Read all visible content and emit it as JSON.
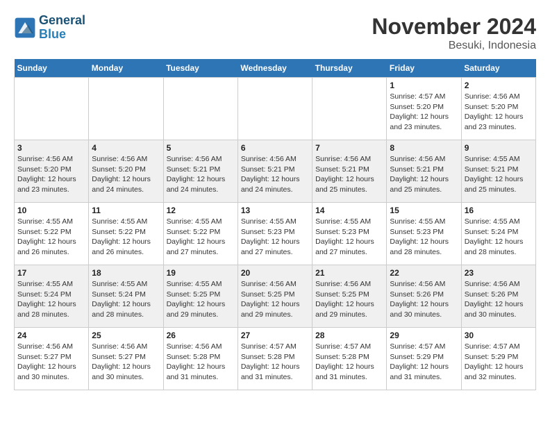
{
  "header": {
    "logo_general": "General",
    "logo_blue": "Blue",
    "month_title": "November 2024",
    "location": "Besuki, Indonesia"
  },
  "weekdays": [
    "Sunday",
    "Monday",
    "Tuesday",
    "Wednesday",
    "Thursday",
    "Friday",
    "Saturday"
  ],
  "weeks": [
    [
      {
        "day": "",
        "info": ""
      },
      {
        "day": "",
        "info": ""
      },
      {
        "day": "",
        "info": ""
      },
      {
        "day": "",
        "info": ""
      },
      {
        "day": "",
        "info": ""
      },
      {
        "day": "1",
        "info": "Sunrise: 4:57 AM\nSunset: 5:20 PM\nDaylight: 12 hours and 23 minutes."
      },
      {
        "day": "2",
        "info": "Sunrise: 4:56 AM\nSunset: 5:20 PM\nDaylight: 12 hours and 23 minutes."
      }
    ],
    [
      {
        "day": "3",
        "info": "Sunrise: 4:56 AM\nSunset: 5:20 PM\nDaylight: 12 hours and 23 minutes."
      },
      {
        "day": "4",
        "info": "Sunrise: 4:56 AM\nSunset: 5:20 PM\nDaylight: 12 hours and 24 minutes."
      },
      {
        "day": "5",
        "info": "Sunrise: 4:56 AM\nSunset: 5:21 PM\nDaylight: 12 hours and 24 minutes."
      },
      {
        "day": "6",
        "info": "Sunrise: 4:56 AM\nSunset: 5:21 PM\nDaylight: 12 hours and 24 minutes."
      },
      {
        "day": "7",
        "info": "Sunrise: 4:56 AM\nSunset: 5:21 PM\nDaylight: 12 hours and 25 minutes."
      },
      {
        "day": "8",
        "info": "Sunrise: 4:56 AM\nSunset: 5:21 PM\nDaylight: 12 hours and 25 minutes."
      },
      {
        "day": "9",
        "info": "Sunrise: 4:55 AM\nSunset: 5:21 PM\nDaylight: 12 hours and 25 minutes."
      }
    ],
    [
      {
        "day": "10",
        "info": "Sunrise: 4:55 AM\nSunset: 5:22 PM\nDaylight: 12 hours and 26 minutes."
      },
      {
        "day": "11",
        "info": "Sunrise: 4:55 AM\nSunset: 5:22 PM\nDaylight: 12 hours and 26 minutes."
      },
      {
        "day": "12",
        "info": "Sunrise: 4:55 AM\nSunset: 5:22 PM\nDaylight: 12 hours and 27 minutes."
      },
      {
        "day": "13",
        "info": "Sunrise: 4:55 AM\nSunset: 5:23 PM\nDaylight: 12 hours and 27 minutes."
      },
      {
        "day": "14",
        "info": "Sunrise: 4:55 AM\nSunset: 5:23 PM\nDaylight: 12 hours and 27 minutes."
      },
      {
        "day": "15",
        "info": "Sunrise: 4:55 AM\nSunset: 5:23 PM\nDaylight: 12 hours and 28 minutes."
      },
      {
        "day": "16",
        "info": "Sunrise: 4:55 AM\nSunset: 5:24 PM\nDaylight: 12 hours and 28 minutes."
      }
    ],
    [
      {
        "day": "17",
        "info": "Sunrise: 4:55 AM\nSunset: 5:24 PM\nDaylight: 12 hours and 28 minutes."
      },
      {
        "day": "18",
        "info": "Sunrise: 4:55 AM\nSunset: 5:24 PM\nDaylight: 12 hours and 28 minutes."
      },
      {
        "day": "19",
        "info": "Sunrise: 4:55 AM\nSunset: 5:25 PM\nDaylight: 12 hours and 29 minutes."
      },
      {
        "day": "20",
        "info": "Sunrise: 4:56 AM\nSunset: 5:25 PM\nDaylight: 12 hours and 29 minutes."
      },
      {
        "day": "21",
        "info": "Sunrise: 4:56 AM\nSunset: 5:25 PM\nDaylight: 12 hours and 29 minutes."
      },
      {
        "day": "22",
        "info": "Sunrise: 4:56 AM\nSunset: 5:26 PM\nDaylight: 12 hours and 30 minutes."
      },
      {
        "day": "23",
        "info": "Sunrise: 4:56 AM\nSunset: 5:26 PM\nDaylight: 12 hours and 30 minutes."
      }
    ],
    [
      {
        "day": "24",
        "info": "Sunrise: 4:56 AM\nSunset: 5:27 PM\nDaylight: 12 hours and 30 minutes."
      },
      {
        "day": "25",
        "info": "Sunrise: 4:56 AM\nSunset: 5:27 PM\nDaylight: 12 hours and 30 minutes."
      },
      {
        "day": "26",
        "info": "Sunrise: 4:56 AM\nSunset: 5:28 PM\nDaylight: 12 hours and 31 minutes."
      },
      {
        "day": "27",
        "info": "Sunrise: 4:57 AM\nSunset: 5:28 PM\nDaylight: 12 hours and 31 minutes."
      },
      {
        "day": "28",
        "info": "Sunrise: 4:57 AM\nSunset: 5:28 PM\nDaylight: 12 hours and 31 minutes."
      },
      {
        "day": "29",
        "info": "Sunrise: 4:57 AM\nSunset: 5:29 PM\nDaylight: 12 hours and 31 minutes."
      },
      {
        "day": "30",
        "info": "Sunrise: 4:57 AM\nSunset: 5:29 PM\nDaylight: 12 hours and 32 minutes."
      }
    ]
  ]
}
